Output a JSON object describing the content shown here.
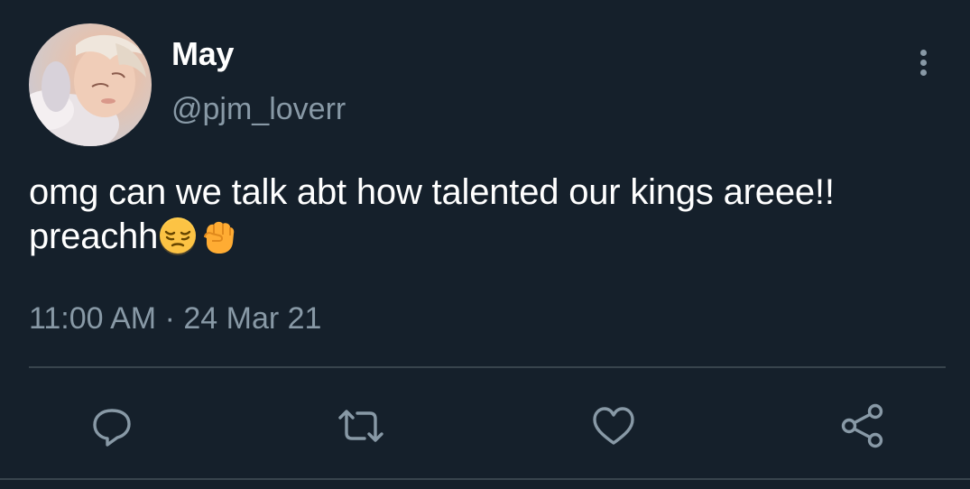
{
  "tweet": {
    "author": {
      "display_name": "May",
      "handle": "@pjm_loverr",
      "avatar_icon": "avatar-photo"
    },
    "text": "omg can we talk abt how talented our kings areee!! preachh",
    "emojis": [
      "pensive-face-emoji",
      "raised-fist-emoji"
    ],
    "time": "11:00 AM",
    "separator": "·",
    "date": "24 Mar 21"
  },
  "actions": {
    "reply_icon": "reply-icon",
    "retweet_icon": "retweet-icon",
    "like_icon": "heart-icon",
    "share_icon": "share-icon",
    "more_icon": "more-vertical-icon"
  },
  "colors": {
    "background": "#15202b",
    "primary_text": "#ffffff",
    "secondary_text": "#8899a6",
    "divider": "#38444d"
  }
}
